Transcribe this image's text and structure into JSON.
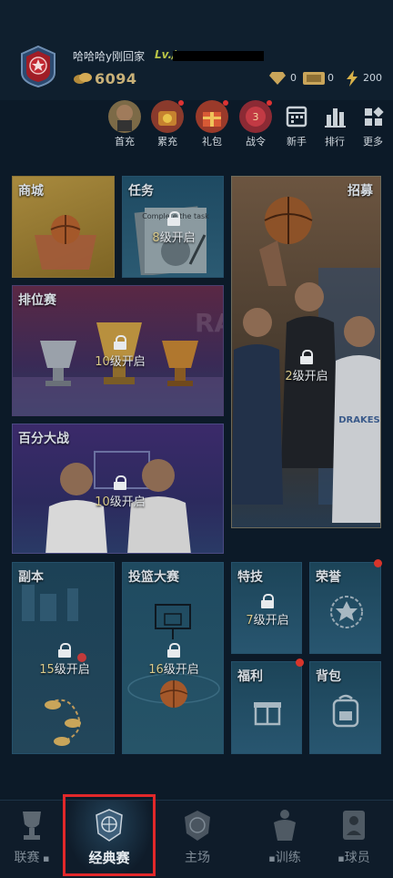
{
  "header": {
    "username": "哈哈哈y刚回家",
    "level_label": "Lv./",
    "coins": "6094",
    "diamond": "0",
    "ticket": "0",
    "energy": "200"
  },
  "quick_menu": [
    {
      "label": "首充",
      "icon": "first-recharge-icon"
    },
    {
      "label": "累充",
      "icon": "cumulative-recharge-icon"
    },
    {
      "label": "礼包",
      "icon": "gift-pack-icon"
    },
    {
      "label": "战令",
      "icon": "battle-pass-icon"
    },
    {
      "label": "新手",
      "icon": "newbie-calendar-icon"
    },
    {
      "label": "排行",
      "icon": "ranking-icon"
    },
    {
      "label": "更多",
      "icon": "more-icon"
    }
  ],
  "tiles": {
    "shop": {
      "title": "商城"
    },
    "task": {
      "title": "任务",
      "lock_num": "8",
      "lock_text": "级开启",
      "banner": "Complete the task"
    },
    "recruit": {
      "title": "招募",
      "lock_num": "2",
      "lock_text": "级开启"
    },
    "ranked": {
      "title": "排位赛",
      "lock_num": "10",
      "lock_text": "级开启"
    },
    "hundred": {
      "title": "百分大战",
      "lock_num": "10",
      "lock_text": "级开启"
    },
    "dungeon": {
      "title": "副本",
      "lock_num": "15",
      "lock_text": "级开启"
    },
    "shootout": {
      "title": "投篮大赛",
      "lock_num": "16",
      "lock_text": "级开启"
    },
    "skill": {
      "title": "特技",
      "lock_num": "7",
      "lock_text": "级开启"
    },
    "honor": {
      "title": "荣誉"
    },
    "welfare": {
      "title": "福利"
    },
    "bag": {
      "title": "背包"
    }
  },
  "nav": {
    "league": "联赛",
    "classic": "经典赛",
    "main": "主场",
    "training": "训练",
    "players": "球员"
  },
  "colors": {
    "background": "#0c1a28",
    "tile_border": "#25506a",
    "highlight": "#e2282a",
    "notification": "#d8352b"
  }
}
